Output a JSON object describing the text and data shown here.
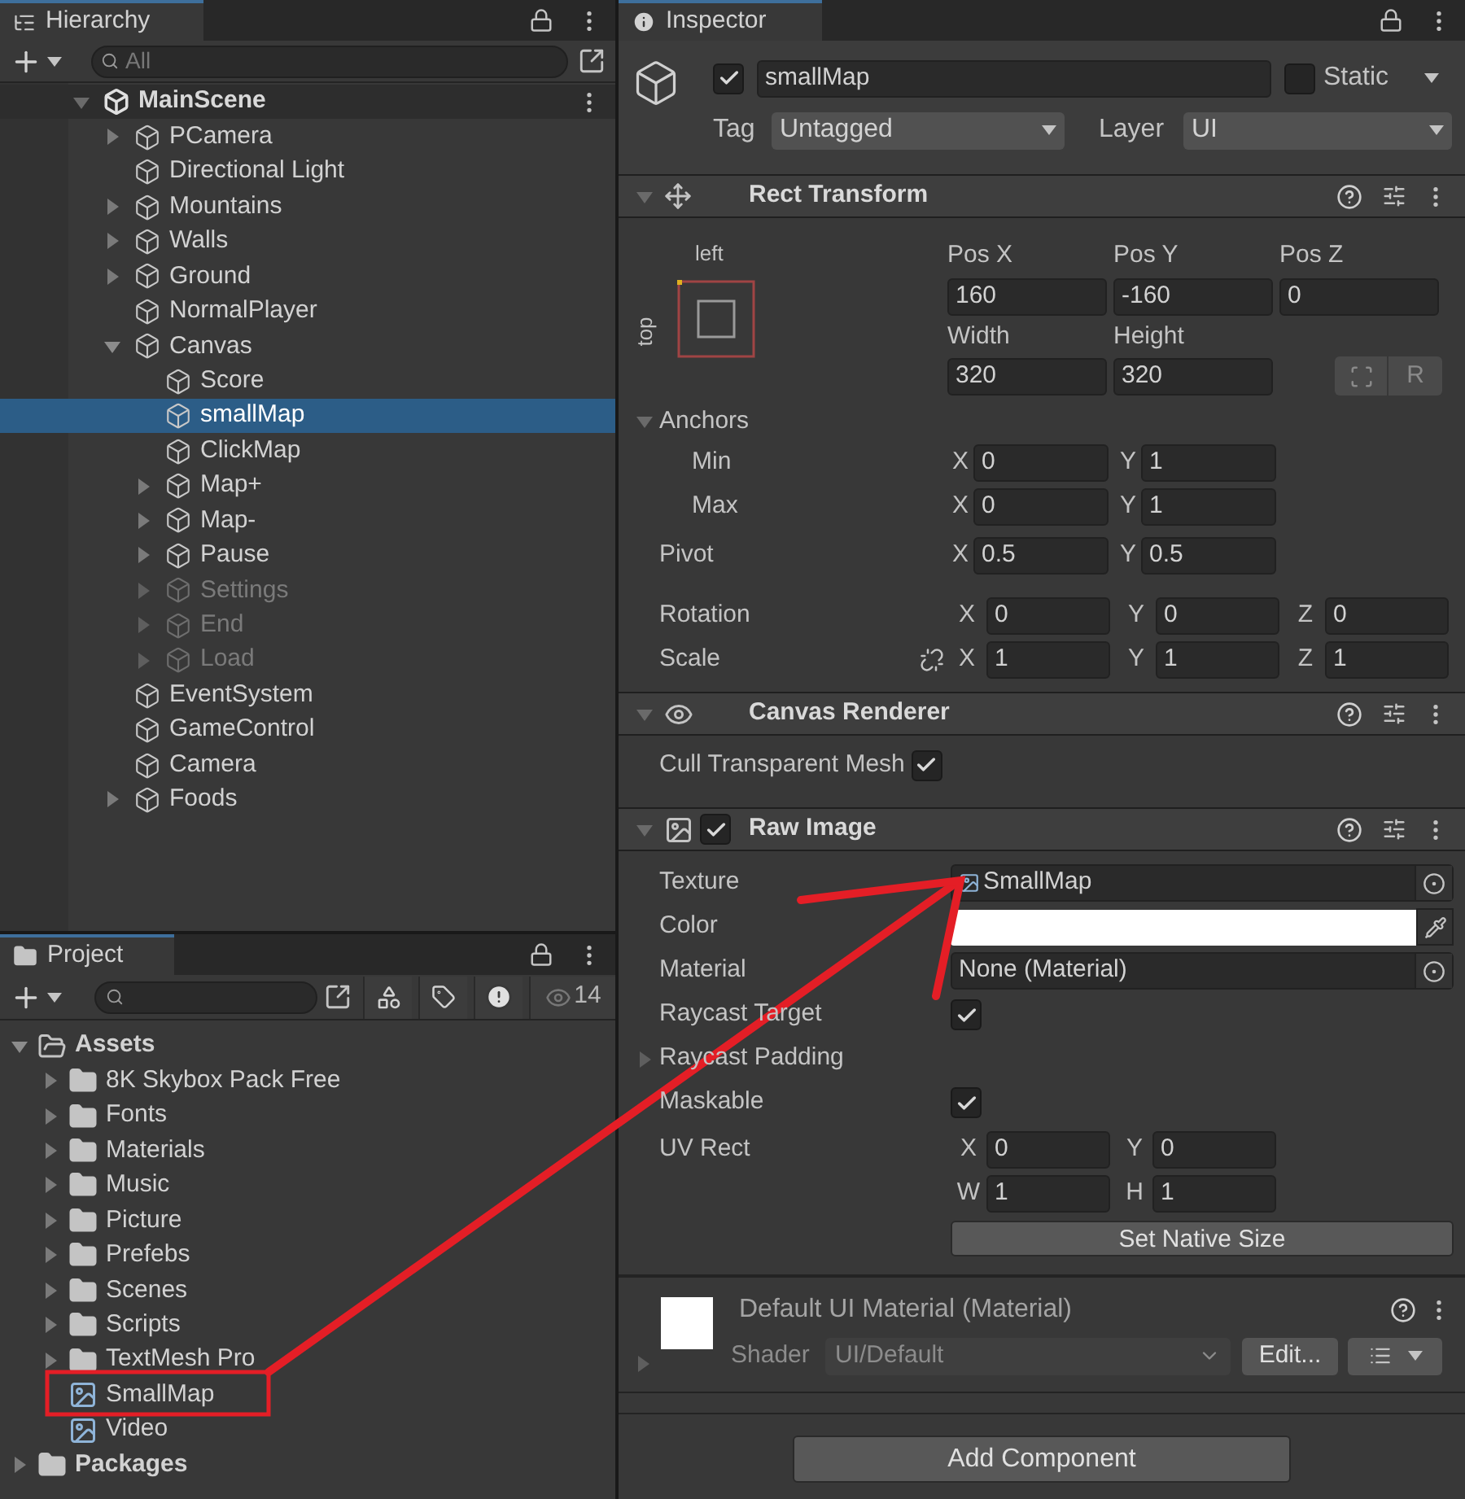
{
  "hierarchy": {
    "title": "Hierarchy",
    "search": {
      "placeholder": "All"
    },
    "scene": {
      "name": "MainScene",
      "expanded": true
    },
    "items": [
      {
        "name": "PCamera",
        "has_children": true,
        "expanded": false,
        "active": true,
        "selected": false
      },
      {
        "name": "Directional Light",
        "has_children": false,
        "expanded": false,
        "active": true,
        "selected": false
      },
      {
        "name": "Mountains",
        "has_children": true,
        "expanded": false,
        "active": true,
        "selected": false
      },
      {
        "name": "Walls",
        "has_children": true,
        "expanded": false,
        "active": true,
        "selected": false
      },
      {
        "name": "Ground",
        "has_children": true,
        "expanded": false,
        "active": true,
        "selected": false
      },
      {
        "name": "NormalPlayer",
        "has_children": false,
        "expanded": false,
        "active": true,
        "selected": false
      },
      {
        "name": "Canvas",
        "has_children": true,
        "expanded": true,
        "active": true,
        "selected": false,
        "children": [
          {
            "name": "Score",
            "has_children": false,
            "expanded": false,
            "active": true,
            "selected": false
          },
          {
            "name": "smallMap",
            "has_children": false,
            "expanded": false,
            "active": true,
            "selected": true
          },
          {
            "name": "ClickMap",
            "has_children": false,
            "expanded": false,
            "active": true,
            "selected": false
          },
          {
            "name": "Map+",
            "has_children": true,
            "expanded": false,
            "active": true,
            "selected": false
          },
          {
            "name": "Map-",
            "has_children": true,
            "expanded": false,
            "active": true,
            "selected": false
          },
          {
            "name": "Pause",
            "has_children": true,
            "expanded": false,
            "active": true,
            "selected": false
          },
          {
            "name": "Settings",
            "has_children": true,
            "expanded": false,
            "active": false,
            "selected": false
          },
          {
            "name": "End",
            "has_children": true,
            "expanded": false,
            "active": false,
            "selected": false
          },
          {
            "name": "Load",
            "has_children": true,
            "expanded": false,
            "active": false,
            "selected": false
          }
        ]
      },
      {
        "name": "EventSystem",
        "has_children": false,
        "expanded": false,
        "active": true,
        "selected": false
      },
      {
        "name": "GameControl",
        "has_children": false,
        "expanded": false,
        "active": true,
        "selected": false
      },
      {
        "name": "Camera",
        "has_children": false,
        "expanded": false,
        "active": true,
        "selected": false
      },
      {
        "name": "Foods",
        "has_children": true,
        "expanded": false,
        "active": true,
        "selected": false
      }
    ]
  },
  "project": {
    "title": "Project",
    "hidden_count": "14",
    "tree": [
      {
        "name": "Assets",
        "kind": "folder",
        "expanded": true,
        "children": [
          {
            "name": "8K Skybox Pack Free",
            "kind": "folder",
            "expanded": false
          },
          {
            "name": "Fonts",
            "kind": "folder",
            "expanded": false
          },
          {
            "name": "Materials",
            "kind": "folder",
            "expanded": false
          },
          {
            "name": "Music",
            "kind": "folder",
            "expanded": false
          },
          {
            "name": "Picture",
            "kind": "folder",
            "expanded": false
          },
          {
            "name": "Prefebs",
            "kind": "folder",
            "expanded": false
          },
          {
            "name": "Scenes",
            "kind": "folder",
            "expanded": false
          },
          {
            "name": "Scripts",
            "kind": "folder",
            "expanded": false
          },
          {
            "name": "TextMesh Pro",
            "kind": "folder",
            "expanded": false
          },
          {
            "name": "SmallMap",
            "kind": "texture"
          },
          {
            "name": "Video",
            "kind": "texture"
          }
        ]
      },
      {
        "name": "Packages",
        "kind": "folder",
        "expanded": false
      }
    ]
  },
  "inspector": {
    "title": "Inspector",
    "object": {
      "active": true,
      "name": "smallMap",
      "static": false,
      "static_label": "Static",
      "tag_label": "Tag",
      "tag": "Untagged",
      "layer_label": "Layer",
      "layer": "UI"
    },
    "rect_transform": {
      "title": "Rect Transform",
      "expanded": true,
      "anchor_horizontal": "left",
      "anchor_vertical": "top",
      "position": [
        {
          "label": "Pos X",
          "value": "160"
        },
        {
          "label": "Pos Y",
          "value": "-160"
        },
        {
          "label": "Pos Z",
          "value": "0"
        }
      ],
      "size": [
        {
          "label": "Width",
          "value": "320"
        },
        {
          "label": "Height",
          "value": "320"
        }
      ],
      "raw_edit_button": "R",
      "anchors": {
        "label": "Anchors",
        "expanded": true,
        "rows": [
          {
            "label": "Min",
            "fields": [
              {
                "axis": "X",
                "value": "0"
              },
              {
                "axis": "Y",
                "value": "1"
              }
            ]
          },
          {
            "label": "Max",
            "fields": [
              {
                "axis": "X",
                "value": "0"
              },
              {
                "axis": "Y",
                "value": "1"
              }
            ]
          }
        ]
      },
      "pivot": {
        "label": "Pivot",
        "fields": [
          {
            "axis": "X",
            "value": "0.5"
          },
          {
            "axis": "Y",
            "value": "0.5"
          }
        ]
      },
      "rotation": {
        "label": "Rotation",
        "fields": [
          {
            "axis": "X",
            "value": "0"
          },
          {
            "axis": "Y",
            "value": "0"
          },
          {
            "axis": "Z",
            "value": "0"
          }
        ]
      },
      "scale": {
        "label": "Scale",
        "linked": false,
        "fields": [
          {
            "axis": "X",
            "value": "1"
          },
          {
            "axis": "Y",
            "value": "1"
          },
          {
            "axis": "Z",
            "value": "1"
          }
        ]
      }
    },
    "canvas_renderer": {
      "title": "Canvas Renderer",
      "expanded": true,
      "rows": [
        {
          "kind": "toggle",
          "label": "Cull Transparent Mesh",
          "checked": true
        }
      ]
    },
    "raw_image": {
      "title": "Raw Image",
      "expanded": true,
      "enabled": true,
      "rows": [
        {
          "kind": "object",
          "label": "Texture",
          "value": "SmallMap",
          "icon": true
        },
        {
          "kind": "color",
          "label": "Color",
          "color": "#ffffff"
        },
        {
          "kind": "object",
          "label": "Material",
          "value": "None (Material)",
          "icon": false
        },
        {
          "kind": "toggle",
          "label": "Raycast Target",
          "checked": true
        },
        {
          "kind": "foldout",
          "label": "Raycast Padding",
          "expanded": false
        },
        {
          "kind": "toggle",
          "label": "Maskable",
          "checked": true
        },
        {
          "kind": "rect",
          "label": "UV Rect",
          "fields": [
            {
              "axis": "X",
              "value": "0"
            },
            {
              "axis": "Y",
              "value": "0"
            },
            {
              "axis": "W",
              "value": "1"
            },
            {
              "axis": "H",
              "value": "1"
            }
          ]
        },
        {
          "kind": "button",
          "label": "Set Native Size"
        }
      ]
    },
    "material": {
      "name": "Default UI Material (Material)",
      "expanded": false,
      "shader_label": "Shader",
      "shader": "UI/Default",
      "edit_button": "Edit..."
    },
    "add_component": "Add Component"
  }
}
